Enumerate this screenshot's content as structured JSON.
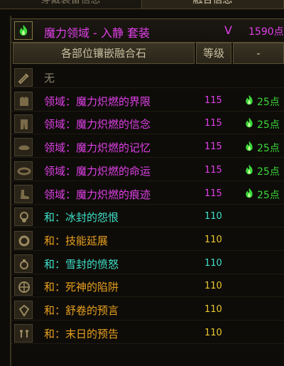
{
  "tabs": [
    {
      "label": "穿戴装备信息"
    },
    {
      "label": "融合信息"
    }
  ],
  "set": {
    "icon": "green-flame-icon",
    "name": "魔力领域 - 入静 套装",
    "v_label": "V",
    "points": "1590点"
  },
  "header": {
    "name": "各部位镶嵌融合石",
    "level": "等级",
    "extra": "-"
  },
  "colors": {
    "magenta": "#e040e8",
    "cyan": "#3ee0c8",
    "orange": "#e8a020",
    "green": "#3ad83a",
    "level_purple": "#e040e8",
    "level_gold": "#e8c830",
    "level_cyan": "#3ee0c8"
  },
  "rows": [
    {
      "slot": "weapon-icon",
      "name": "无",
      "level": "",
      "bonus": ""
    },
    {
      "slot": "coat-icon",
      "name": "领域：魔力炽燃的界限",
      "level": "115",
      "bonus": "25点"
    },
    {
      "slot": "pants-icon",
      "name": "领域：魔力炽燃的信念",
      "level": "115",
      "bonus": "25点"
    },
    {
      "slot": "shoulder-icon",
      "name": "领域：魔力炽燃的记忆",
      "level": "115",
      "bonus": "25点"
    },
    {
      "slot": "belt-icon",
      "name": "领域：魔力炽燃的命运",
      "level": "115",
      "bonus": "25点"
    },
    {
      "slot": "shoes-icon",
      "name": "领域：魔力炽燃的痕迹",
      "level": "115",
      "bonus": "25点"
    },
    {
      "slot": "amulet-icon",
      "name": "和：冰封的怨恨",
      "level": "110",
      "bonus": ""
    },
    {
      "slot": "bracelet-icon",
      "name": "和：技能延展",
      "level": "110",
      "bonus": ""
    },
    {
      "slot": "ring-icon",
      "name": "和：雪封的愤怒",
      "level": "110",
      "bonus": ""
    },
    {
      "slot": "support-icon",
      "name": "和：死神的陷阱",
      "level": "110",
      "bonus": ""
    },
    {
      "slot": "stone-icon",
      "name": "和：舒卷的预言",
      "level": "110",
      "bonus": ""
    },
    {
      "slot": "earring-icon",
      "name": "和：末日的预告",
      "level": "110",
      "bonus": ""
    }
  ]
}
